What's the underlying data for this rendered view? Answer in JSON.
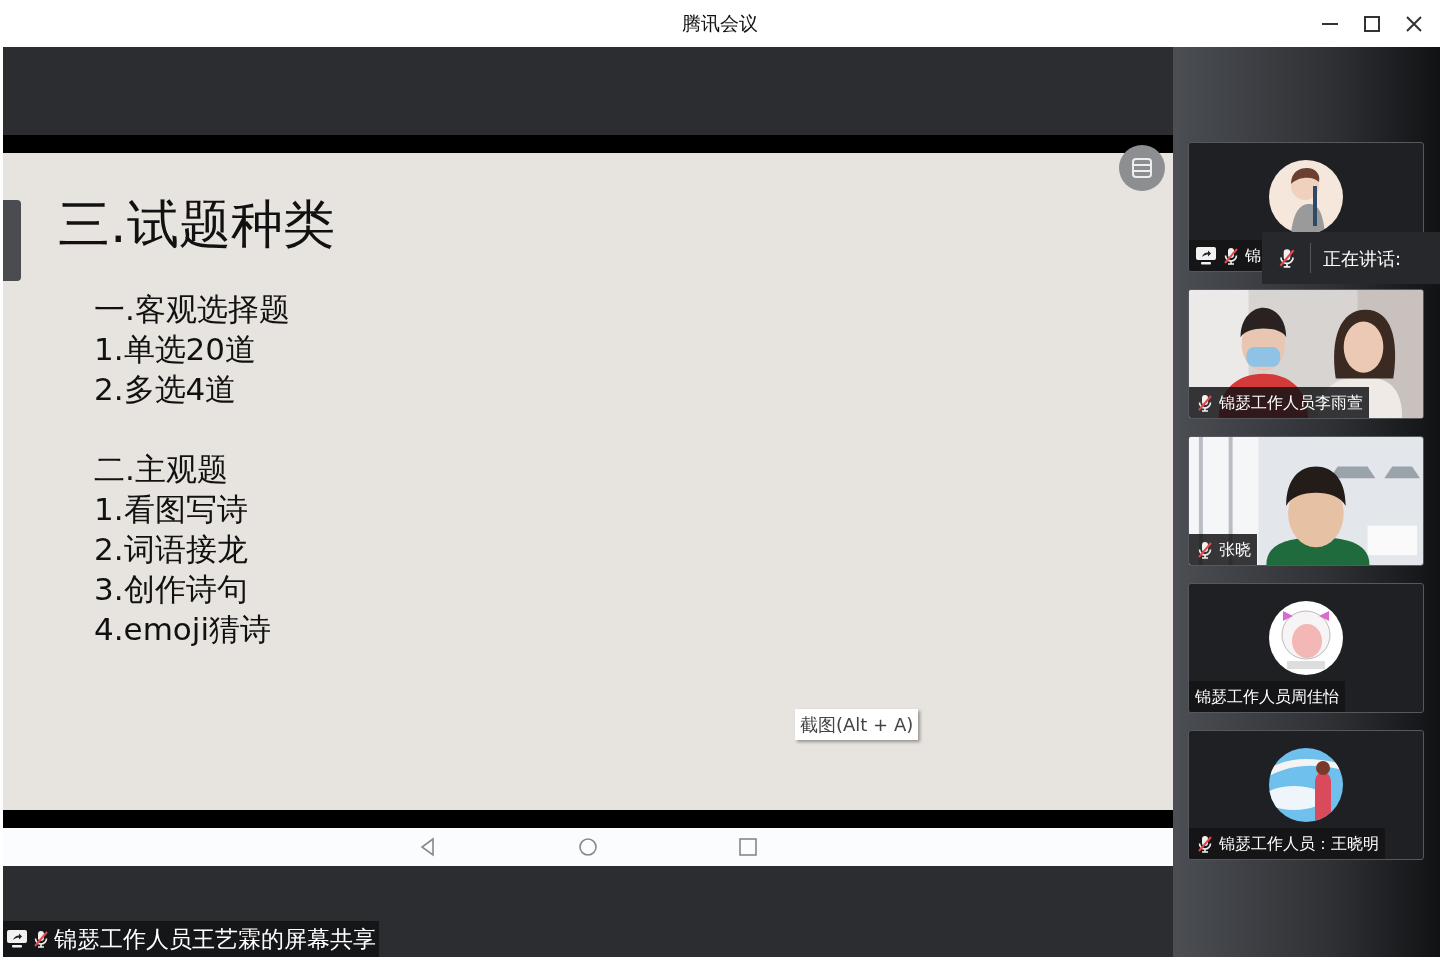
{
  "window": {
    "title": "腾讯会议"
  },
  "slide": {
    "title": "三.试题种类",
    "sections": [
      {
        "heading": "一.客观选择题",
        "items": [
          "1.单选20道",
          "2.多选4道"
        ]
      },
      {
        "heading": "二.主观题",
        "items": [
          "1.看图写诗",
          "2.词语接龙",
          "3.创作诗句",
          "4.emoji猜诗"
        ]
      }
    ]
  },
  "screenshot_tooltip": "截图(Alt + A)",
  "share_label": {
    "text": "锦瑟工作人员王艺霖的屏幕共享",
    "sharing": true,
    "muted": true
  },
  "participants": [
    {
      "kind": "avatar",
      "name": "锦",
      "muted": true,
      "sharing": true
    },
    {
      "kind": "video",
      "name": "锦瑟工作人员李雨萱",
      "muted": true,
      "sharing": false
    },
    {
      "kind": "video",
      "name": "张晓",
      "muted": true,
      "sharing": false
    },
    {
      "kind": "avatar",
      "name": "锦瑟工作人员周佳怡",
      "muted": false,
      "sharing": false
    },
    {
      "kind": "avatar",
      "name": "锦瑟工作人员：王晓明",
      "muted": true,
      "sharing": false
    }
  ],
  "speaking_popup": {
    "label": "正在讲话:",
    "muted": true
  }
}
